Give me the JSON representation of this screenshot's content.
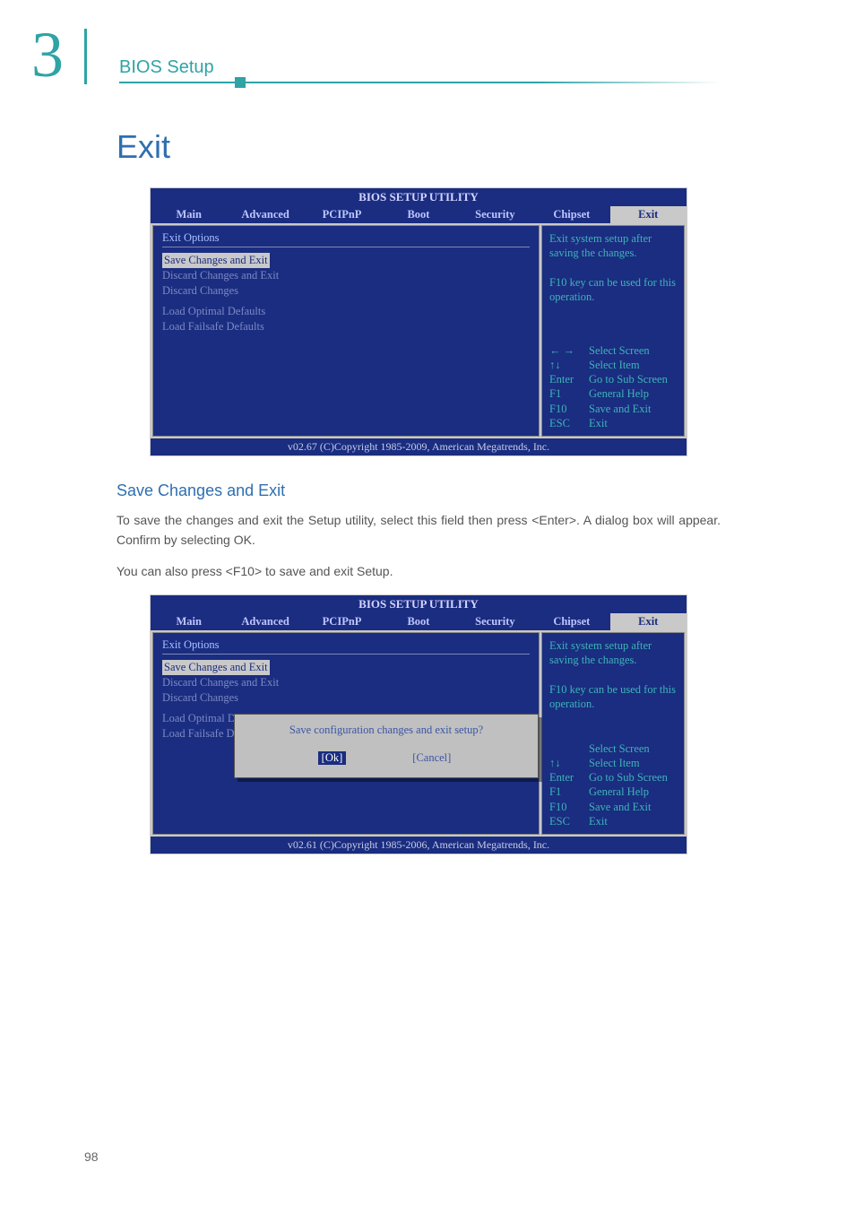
{
  "header": {
    "chapter_num": "3",
    "section_label": "BIOS Setup"
  },
  "page": {
    "title": "Exit",
    "subhead": "Save Changes and Exit",
    "para1": "To save the changes and exit the Setup utility, select this field then press <Enter>. A dialog box will appear. Confirm by selecting OK.",
    "para2": "You can also press <F10> to save and exit Setup.",
    "number": "98"
  },
  "bios1": {
    "title": "BIOS SETUP UTILITY",
    "tabs": [
      "Main",
      "Advanced",
      "PCIPnP",
      "Boot",
      "Security",
      "Chipset",
      "Exit"
    ],
    "active_tab": "Exit",
    "options_header": "Exit Options",
    "options": [
      "Save Changes and Exit",
      "Discard Changes and Exit",
      "Discard Changes",
      "Load Optimal Defaults",
      "Load Failsafe Defaults"
    ],
    "selected_index": 0,
    "help_text": "Exit system setup after saving the changes.\n\nF10 key can be used for this operation.",
    "keys": [
      {
        "k": "← →",
        "d": "Select Screen"
      },
      {
        "k": "↑↓",
        "d": "Select Item"
      },
      {
        "k": "Enter",
        "d": "Go to Sub Screen"
      },
      {
        "k": "F1",
        "d": "General Help"
      },
      {
        "k": "F10",
        "d": "Save and Exit"
      },
      {
        "k": "ESC",
        "d": "Exit"
      }
    ],
    "footer": "v02.67 (C)Copyright 1985-2009, American Megatrends, Inc."
  },
  "bios2": {
    "title": "BIOS SETUP UTILITY",
    "tabs": [
      "Main",
      "Advanced",
      "PCIPnP",
      "Boot",
      "Security",
      "Chipset",
      "Exit"
    ],
    "active_tab": "Exit",
    "options_header": "Exit Options",
    "options": [
      "Save Changes and Exit",
      "Discard Changes and Exit",
      "Discard Changes",
      "Load Optimal D",
      "Load Failsafe D"
    ],
    "selected_index": 0,
    "help_text": "Exit system setup after saving the changes.\n\nF10 key can be used for this operation.",
    "keys": [
      {
        "k": "↑↓",
        "d": "Select Item"
      },
      {
        "k": "Enter",
        "d": "Go to Sub Screen"
      },
      {
        "k": "F1",
        "d": "General Help"
      },
      {
        "k": "F10",
        "d": "Save and Exit"
      },
      {
        "k": "ESC",
        "d": "Exit"
      }
    ],
    "select_screen_label": "Select Screen",
    "dialog": {
      "message": "Save configuration changes and exit setup?",
      "ok": "[Ok]",
      "cancel": "[Cancel]"
    },
    "footer": "v02.61 (C)Copyright 1985-2006, American Megatrends, Inc."
  }
}
